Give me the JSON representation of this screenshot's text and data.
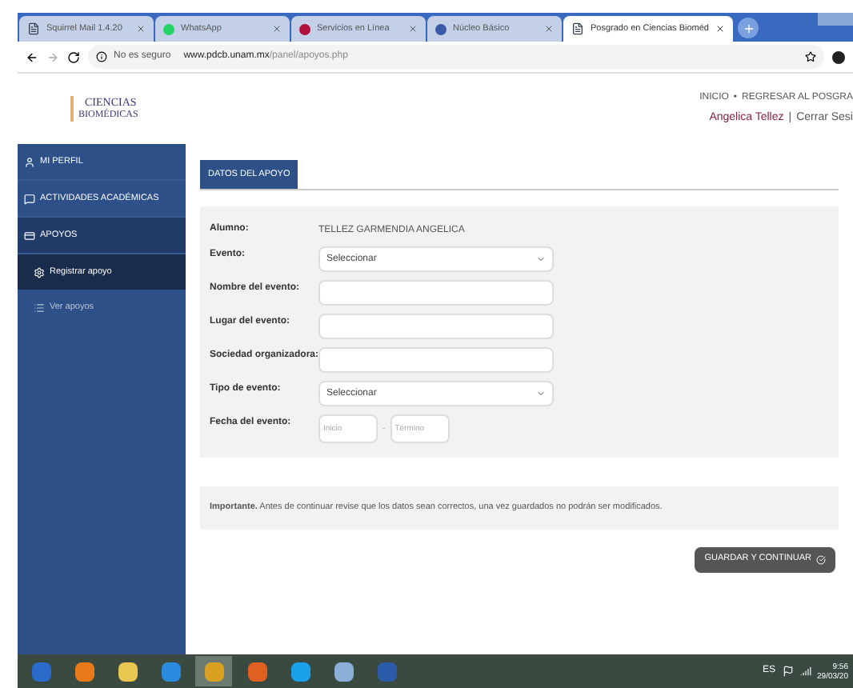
{
  "browser_tabs": [
    {
      "title": "Squirrel Mail 1.4.20",
      "selected": false
    },
    {
      "title": "WhatsApp",
      "selected": false
    },
    {
      "title": "Servicios en Línea",
      "selected": false
    },
    {
      "title": "Núcleo Básico",
      "selected": false
    },
    {
      "title": "Posgrado en Ciencias Bioméd",
      "selected": true
    }
  ],
  "address_bar": {
    "security": "No es seguro",
    "domain": "www.pdcb.unam.mx",
    "path": "/panel/apoyos.php"
  },
  "header": {
    "logo_lines": [
      "CIENCIAS",
      "BIOMÉDICAS"
    ],
    "nav_links": [
      "INICIO",
      "REGRESAR AL POSGRA"
    ],
    "nav_separator": "•",
    "user_separator": "|",
    "user_name": "Angelica Tellez",
    "logout": "Cerrar Sesi"
  },
  "sidebar": {
    "items": [
      {
        "label": "MI PERFIL",
        "expanded": false
      },
      {
        "label": "ACTIVIDADES ACADÉMICAS",
        "expanded": false
      },
      {
        "label": "APOYOS",
        "expanded": true,
        "children": [
          {
            "label": "Registrar apoyo",
            "selected": true
          },
          {
            "label": "Ver apoyos",
            "selected": false
          }
        ]
      }
    ]
  },
  "panel": {
    "tab": "DATOS DEL APOYO",
    "fields": [
      {
        "kind": "text",
        "label": "Alumno:",
        "value": "TELLEZ GARMENDIA ANGELICA"
      },
      {
        "kind": "select",
        "label": "Evento:",
        "value": "Seleccionar"
      },
      {
        "kind": "input",
        "label": "Nombre del evento:"
      },
      {
        "kind": "input",
        "label": "Lugar del evento:"
      },
      {
        "kind": "input",
        "label": "Sociedad organizadora:"
      },
      {
        "kind": "select",
        "label": "Tipo de evento:",
        "value": "Seleccionar"
      },
      {
        "kind": "daterange",
        "label": "Fecha del evento:",
        "start_placeholder": "Inicio",
        "separator": "-",
        "end_placeholder": "Término"
      }
    ],
    "notice": "**Importante.** Antes de continuar revise que los datos sean correctos, una vez guardados no podrán ser modificados.",
    "submit": "GUARDAR Y CONTINUAR"
  },
  "taskbar": {
    "apps": [
      {
        "selected": false
      },
      {
        "selected": false
      },
      {
        "selected": false
      },
      {
        "selected": false
      },
      {
        "selected": true
      },
      {
        "selected": false
      },
      {
        "selected": false
      },
      {
        "selected": false
      },
      {
        "selected": false
      }
    ],
    "language": "ES",
    "time": "9:56",
    "date": "29/03/20"
  }
}
